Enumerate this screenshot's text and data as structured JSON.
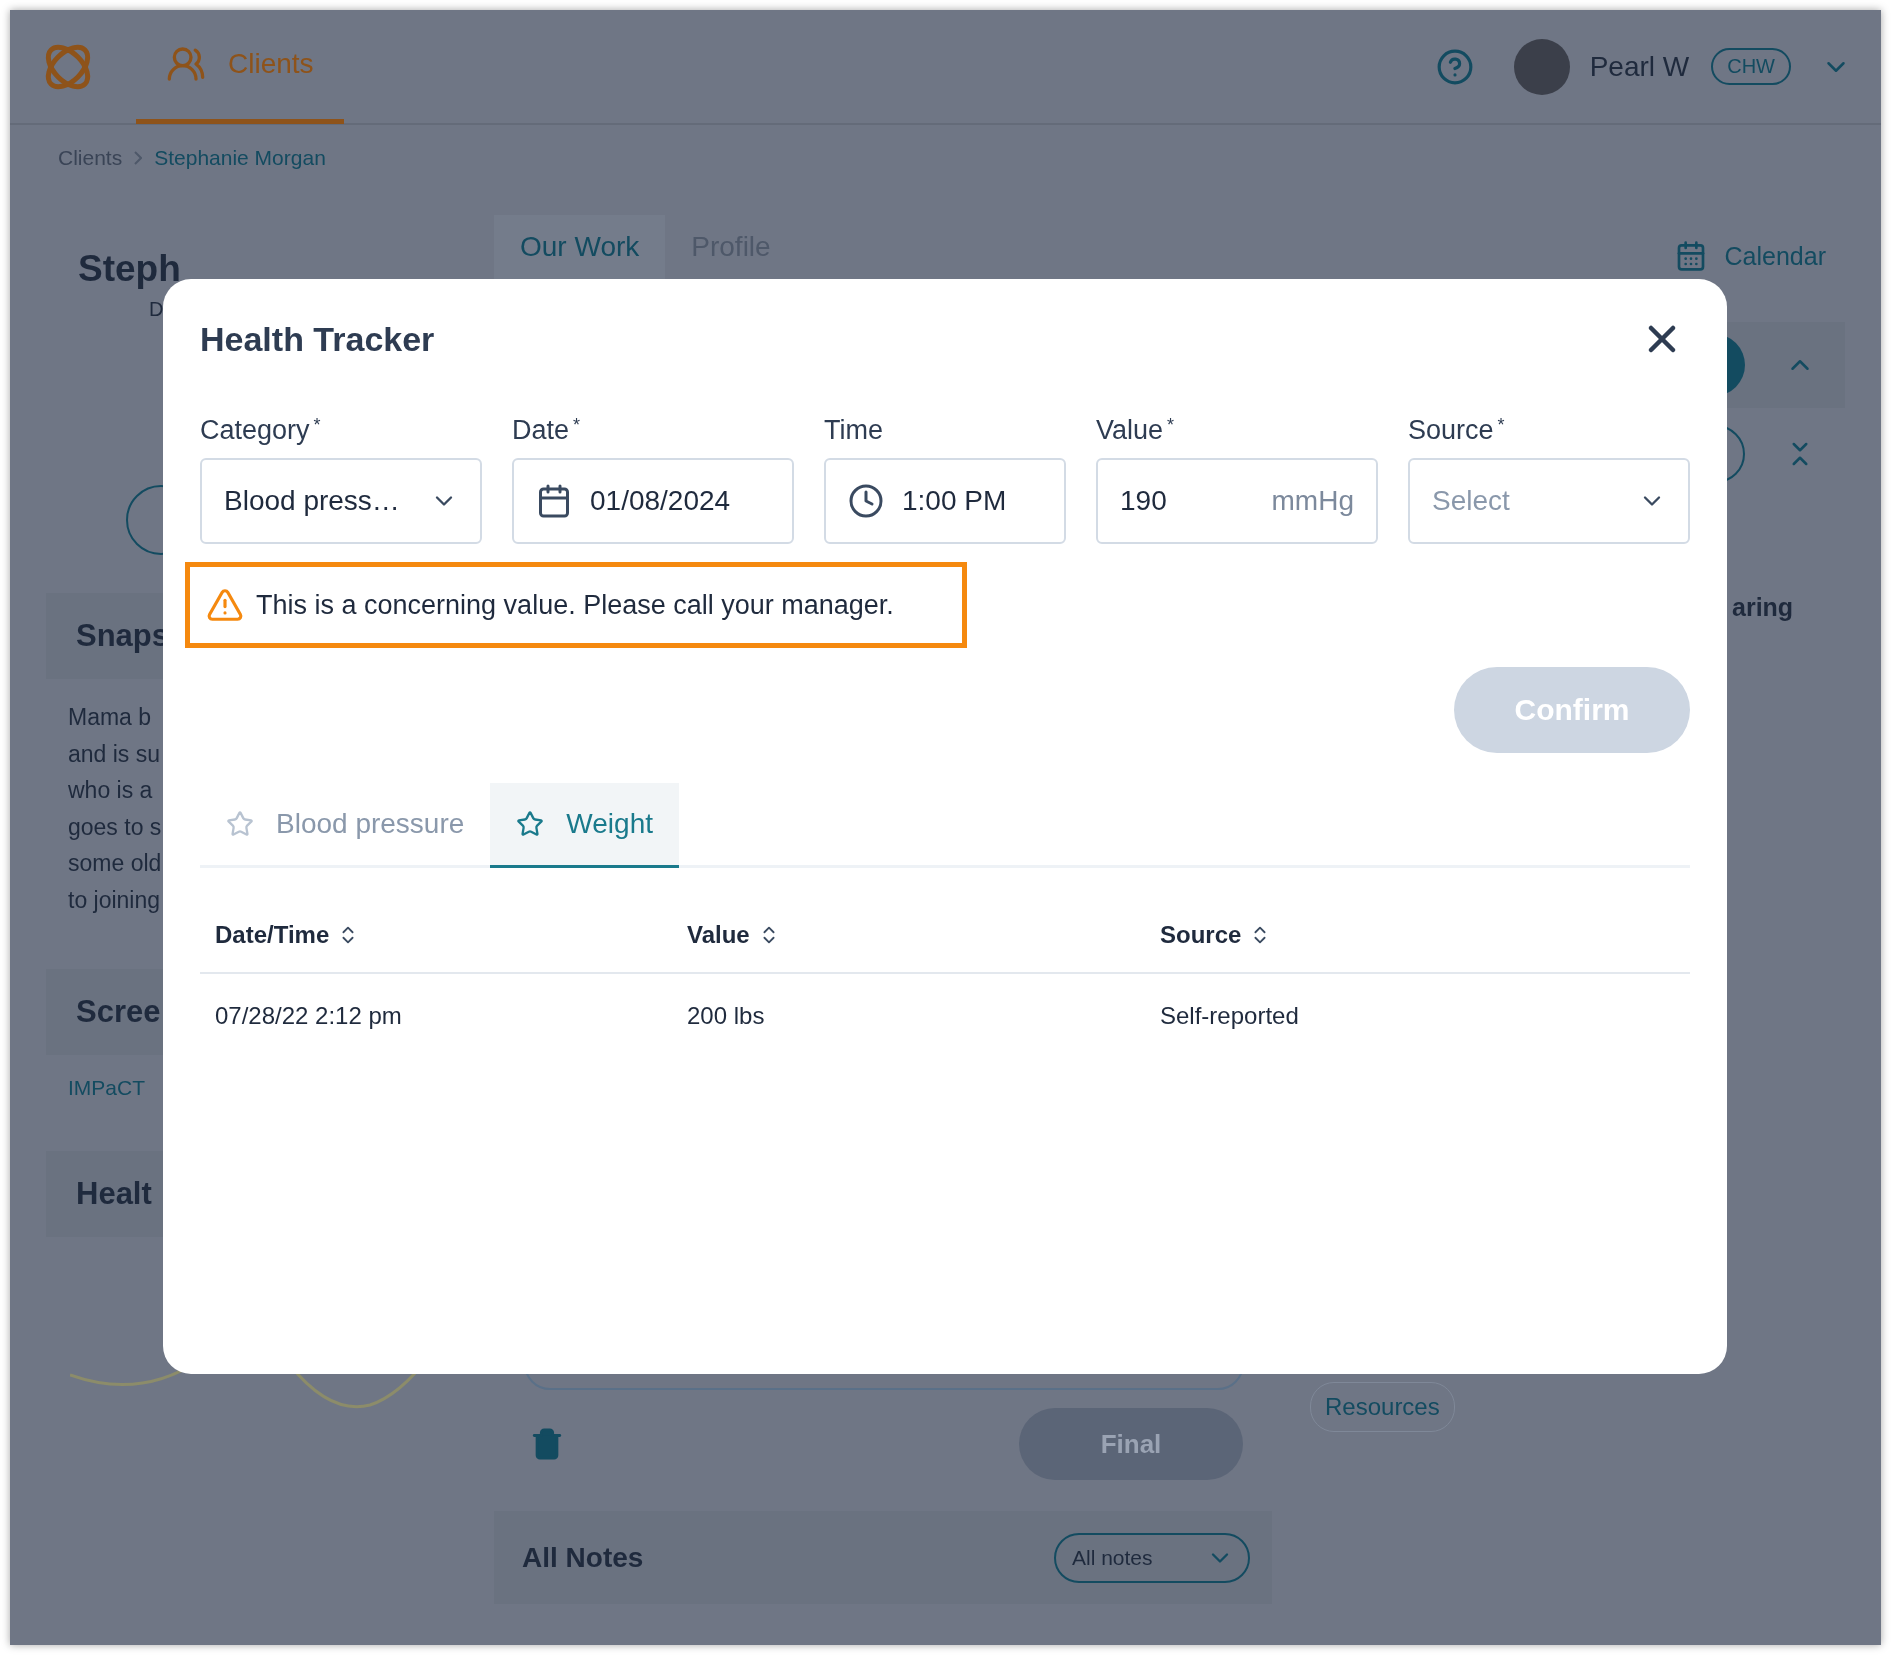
{
  "top_bar": {
    "nav_tab": {
      "label": "Clients",
      "selected": true
    },
    "user": {
      "name": "Pearl W",
      "role": "CHW"
    }
  },
  "breadcrumb": [
    "Clients",
    "Stephanie Morgan"
  ],
  "client_panel": {
    "name": "Steph",
    "subtitle": "D",
    "snapshot": {
      "title": "Snaps",
      "lines": [
        "Mama b",
        "and is su",
        "who is a",
        "goes to s",
        "some old",
        "to joining"
      ]
    },
    "screenings": {
      "title": "Scree",
      "link": "IMPaCT"
    },
    "health": {
      "title": "Healt"
    }
  },
  "main_tabs": [
    {
      "label": "Our Work",
      "selected": true
    },
    {
      "label": "Profile",
      "selected": false
    }
  ],
  "note_actions": {
    "final_button": {
      "label": "Final",
      "disabled": true
    }
  },
  "all_notes": {
    "title": "All Notes",
    "filter": "All notes"
  },
  "right_panel": {
    "calendar_link": "Calendar",
    "section_fragment": "aring",
    "tag": "Resources"
  },
  "modal": {
    "title": "Health Tracker",
    "fields": [
      {
        "kind": "select",
        "label": "Category",
        "required_mark": "*",
        "value": "Blood press…"
      },
      {
        "kind": "date",
        "label": "Date",
        "required_mark": "*",
        "value": "01/08/2024"
      },
      {
        "kind": "time",
        "label": "Time",
        "value": "1:00 PM"
      },
      {
        "kind": "number",
        "label": "Value",
        "required_mark": "*",
        "value": "190",
        "unit": "mmHg"
      },
      {
        "kind": "select",
        "label": "Source",
        "required_mark": "*",
        "placeholder": "Select"
      }
    ],
    "warning": "This is a concerning value. Please call your manager.",
    "confirm": {
      "label": "Confirm",
      "disabled": true
    },
    "history_tabs": [
      {
        "label": "Blood pressure",
        "selected": false
      },
      {
        "label": "Weight",
        "selected": true
      }
    ],
    "table": {
      "columns": [
        "Date/Time",
        "Value",
        "Source"
      ],
      "rows": [
        [
          "07/28/22 2:12 pm",
          "200 lbs",
          "Self-reported"
        ]
      ]
    }
  }
}
